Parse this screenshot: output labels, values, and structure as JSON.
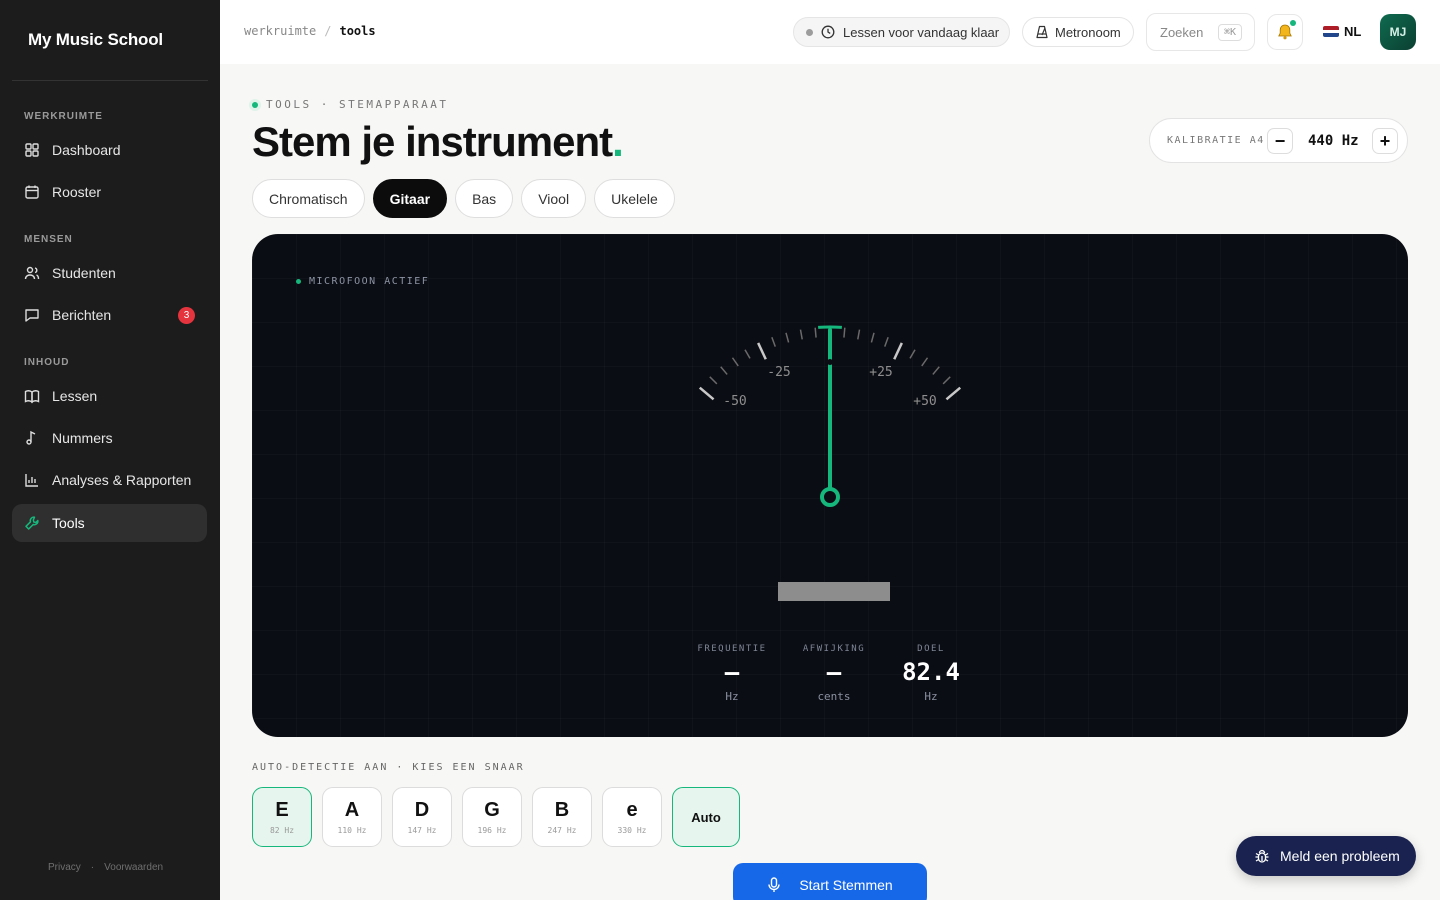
{
  "brand": "My Music School",
  "sidebar": {
    "sections": [
      {
        "label": "WERKRUIMTE"
      },
      {
        "label": "MENSEN"
      },
      {
        "label": "INHOUD"
      }
    ],
    "items": [
      {
        "label": "Dashboard",
        "icon": "dashboard-icon"
      },
      {
        "label": "Rooster",
        "icon": "calendar-icon"
      },
      {
        "label": "Studenten",
        "icon": "users-icon"
      },
      {
        "label": "Berichten",
        "icon": "message-icon",
        "badge": "3"
      },
      {
        "label": "Lessen",
        "icon": "book-icon"
      },
      {
        "label": "Nummers",
        "icon": "music-note-icon"
      },
      {
        "label": "Analyses & Rapporten",
        "icon": "bar-chart-icon"
      },
      {
        "label": "Tools",
        "icon": "wrench-icon",
        "active": true
      }
    ],
    "footer": {
      "privacy": "Privacy",
      "sep": "·",
      "terms": "Voorwaarden"
    }
  },
  "topbar": {
    "breadcrumb": {
      "root": "werkruimte",
      "sep": "/",
      "current": "tools"
    },
    "status": "Lessen voor vandaag klaar",
    "metronome": "Metronoom",
    "search_placeholder": "Zoeken",
    "search_shortcut": "⌘K",
    "language": "NL",
    "avatar": "MJ"
  },
  "page": {
    "eyebrow": "TOOLS · STEMAPPARAAT",
    "title": "Stem je instrument",
    "title_dot": ".",
    "calibration": {
      "label": "KALIBRATIE A4",
      "minus": "−",
      "value": "440 Hz",
      "plus": "+"
    },
    "tabs": [
      {
        "label": "Chromatisch"
      },
      {
        "label": "Gitaar",
        "active": true
      },
      {
        "label": "Bas"
      },
      {
        "label": "Viool"
      },
      {
        "label": "Ukelele"
      }
    ]
  },
  "tuner": {
    "mic_status": "MICROFOON ACTIEF",
    "scale_labels": {
      "m50": "-50",
      "m25": "-25",
      "p25": "+25",
      "p50": "+50"
    },
    "needle_cents": 0,
    "stats": {
      "frequency": {
        "label": "FREQUENTIE",
        "value": "—",
        "unit": "Hz"
      },
      "deviation": {
        "label": "AFWIJKING",
        "value": "—",
        "unit": "cents"
      },
      "target": {
        "label": "DOEL",
        "value": "82.4",
        "unit": "Hz"
      }
    }
  },
  "strings": {
    "label": "AUTO-DETECTIE AAN · KIES EEN SNAAR",
    "items": [
      {
        "note": "E",
        "hz": "82 Hz",
        "active": true
      },
      {
        "note": "A",
        "hz": "110 Hz"
      },
      {
        "note": "D",
        "hz": "147 Hz"
      },
      {
        "note": "G",
        "hz": "196 Hz"
      },
      {
        "note": "B",
        "hz": "247 Hz"
      },
      {
        "note": "e",
        "hz": "330 Hz"
      }
    ],
    "auto": "Auto"
  },
  "actions": {
    "start": "Start Stemmen",
    "report": "Meld een probleem"
  },
  "colors": {
    "accent": "#16b77c",
    "primary": "#1768e8",
    "dark": "#0b0d14"
  }
}
